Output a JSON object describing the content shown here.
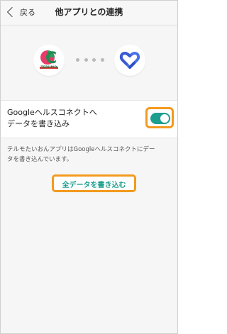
{
  "header": {
    "back_label": "戻る",
    "title": "他アプリとの連携"
  },
  "apps": {
    "left": {
      "name": "TERUMO",
      "icon": "terumo-app-icon"
    },
    "right": {
      "icon": "google-health-connect-icon"
    },
    "link_icon": "connection-dots-icon"
  },
  "toggle_row": {
    "label_line1": "Googleヘルスコネクトへ",
    "label_line2": "データを書き込み",
    "enabled": true
  },
  "description": {
    "line1": "テルモたいおんアプリはGoogleヘルスコネクトにデー",
    "line2": "タを書き込んでいます。"
  },
  "write_all_button": {
    "label": "全データを書き込む"
  },
  "colors": {
    "accent": "#1e9e8e",
    "highlight": "#f39a1f",
    "terumo_green": "#1a7a46"
  }
}
